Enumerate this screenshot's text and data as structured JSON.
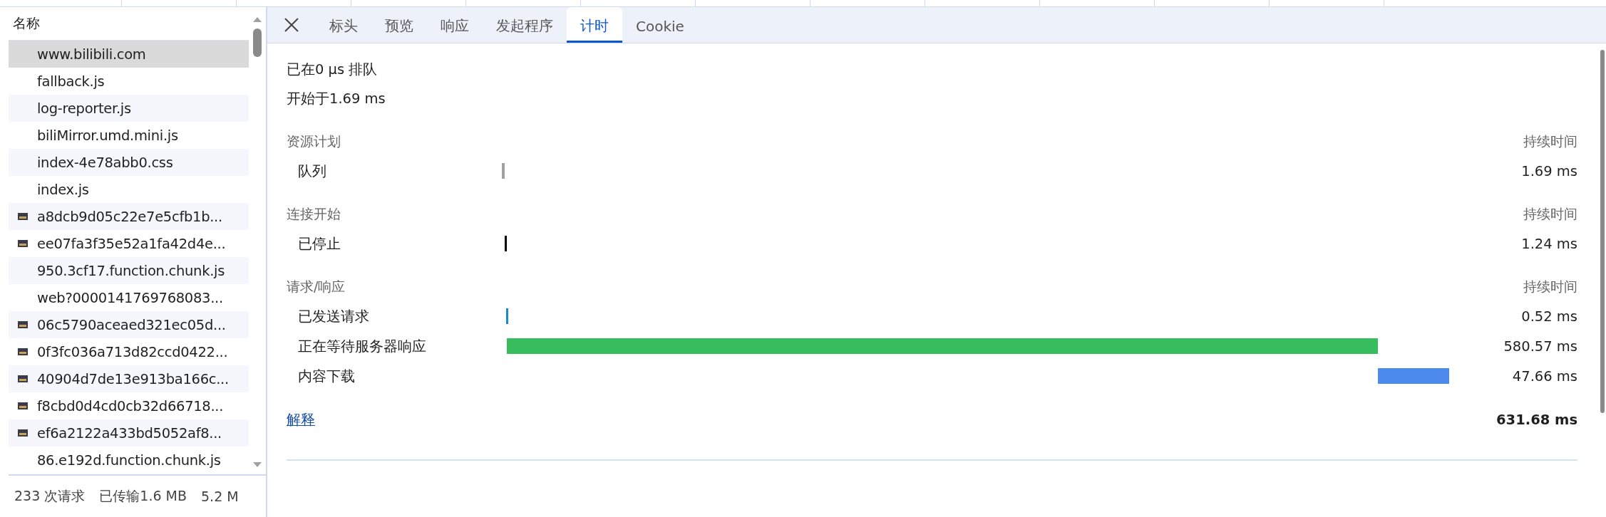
{
  "requests": {
    "header": "名称",
    "rows": [
      {
        "name": "www.bilibili.com",
        "kind": "doc",
        "selected": true
      },
      {
        "name": "fallback.js",
        "kind": "doc",
        "selected": false
      },
      {
        "name": "log-reporter.js",
        "kind": "doc",
        "selected": false
      },
      {
        "name": "biliMirror.umd.mini.js",
        "kind": "doc",
        "selected": false
      },
      {
        "name": "index-4e78abb0.css",
        "kind": "doc",
        "selected": false
      },
      {
        "name": "index.js",
        "kind": "doc",
        "selected": false
      },
      {
        "name": "a8dcb9d05c22e7e5cfb1b...",
        "kind": "image",
        "selected": false
      },
      {
        "name": "ee07fa3f35e52a1fa42d4e...",
        "kind": "image",
        "selected": false
      },
      {
        "name": "950.3cf17.function.chunk.js",
        "kind": "doc",
        "selected": false
      },
      {
        "name": "web?0000141769768083...",
        "kind": "doc",
        "selected": false
      },
      {
        "name": "06c5790aceaed321ec05d...",
        "kind": "image",
        "selected": false
      },
      {
        "name": "0f3fc036a713d82ccd0422...",
        "kind": "image",
        "selected": false
      },
      {
        "name": "40904d7de13e913ba166c...",
        "kind": "image",
        "selected": false
      },
      {
        "name": "f8cbd0d4cd0cb32d66718...",
        "kind": "image",
        "selected": false
      },
      {
        "name": "ef6a2122a433bd5052af8...",
        "kind": "image",
        "selected": false
      },
      {
        "name": "86.e192d.function.chunk.js",
        "kind": "doc",
        "selected": false
      }
    ]
  },
  "status_bar": [
    "233 次请求",
    "已传输1.6 MB",
    "5.2 M"
  ],
  "tabs": [
    {
      "label": "标头",
      "selected": false
    },
    {
      "label": "预览",
      "selected": false
    },
    {
      "label": "响应",
      "selected": false
    },
    {
      "label": "发起程序",
      "selected": false
    },
    {
      "label": "计时",
      "selected": true
    },
    {
      "label": "Cookie",
      "selected": false
    }
  ],
  "summary": [
    "已在0 μs 排队",
    "开始于1.69 ms"
  ],
  "sections": [
    {
      "title": "资源计划",
      "duration_header": "持续时间",
      "rows": [
        {
          "label": "队列",
          "color": "#a0a0a0",
          "duration": "1.69 ms"
        }
      ]
    },
    {
      "title": "连接开始",
      "duration_header": "持续时间",
      "rows": [
        {
          "label": "已停止",
          "color": "#000000",
          "duration": "1.24 ms"
        }
      ]
    },
    {
      "title": "请求/响应",
      "duration_header": "持续时间",
      "rows": [
        {
          "label": "已发送请求",
          "color": "#1a8ad0",
          "duration": "0.52 ms"
        },
        {
          "label": "正在等待服务器响应",
          "color": "#37bd5e",
          "duration": "580.57 ms"
        },
        {
          "label": "内容下载",
          "color": "#4d8af0",
          "duration": "47.66 ms"
        }
      ]
    }
  ],
  "explain_link": "解释",
  "total": "631.68 ms"
}
